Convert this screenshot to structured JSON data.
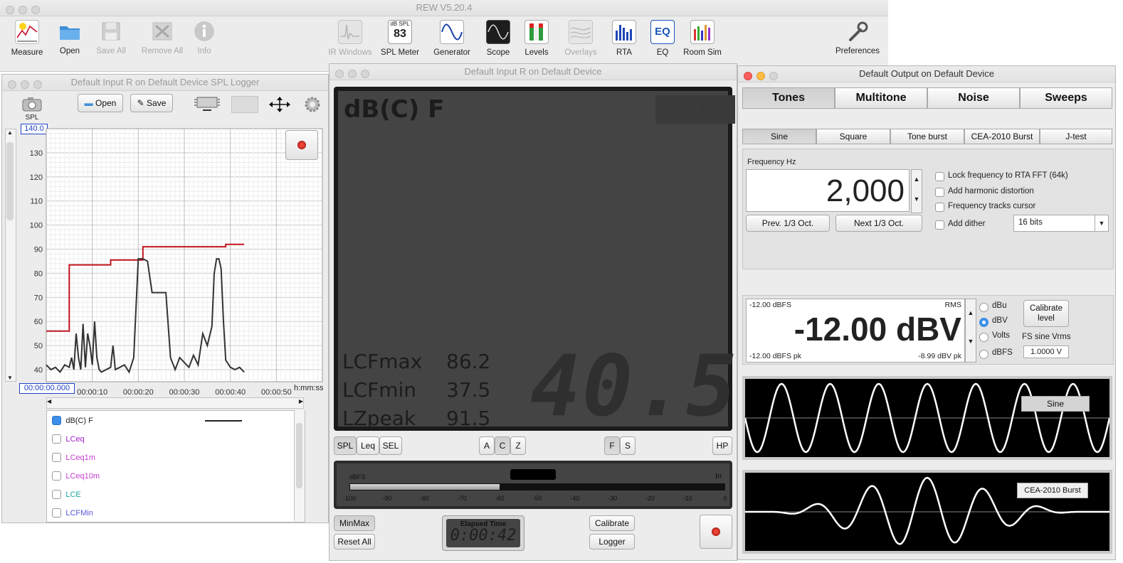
{
  "app": {
    "title": "REW V5.20.4"
  },
  "colors": {
    "accent": "#3b8fe8",
    "trace_max": "#c0141c",
    "trace_spl": "#333333"
  },
  "toolbar": [
    {
      "label": "Measure",
      "enabled": true,
      "icon": "measure-icon"
    },
    {
      "label": "Open",
      "enabled": true,
      "icon": "folder-icon"
    },
    {
      "label": "Save All",
      "enabled": false,
      "icon": "floppy-icon"
    },
    {
      "label": "Remove All",
      "enabled": false,
      "icon": "remove-icon"
    },
    {
      "label": "Info",
      "enabled": false,
      "icon": "info-icon"
    },
    {
      "label": "IR Windows",
      "enabled": false,
      "icon": "ir-windows-icon"
    },
    {
      "label": "SPL Meter",
      "enabled": true,
      "icon": "spl-meter-icon",
      "badge_top": "dB SPL",
      "badge_value": "83"
    },
    {
      "label": "Generator",
      "enabled": true,
      "icon": "sine-wave-icon"
    },
    {
      "label": "Scope",
      "enabled": true,
      "icon": "scope-icon"
    },
    {
      "label": "Levels",
      "enabled": true,
      "icon": "levels-icon"
    },
    {
      "label": "Overlays",
      "enabled": false,
      "icon": "overlays-icon"
    },
    {
      "label": "RTA",
      "enabled": true,
      "icon": "rta-icon"
    },
    {
      "label": "EQ",
      "enabled": true,
      "icon": "eq-icon",
      "badge_value": "EQ"
    },
    {
      "label": "Room Sim",
      "enabled": true,
      "icon": "room-sim-icon"
    },
    {
      "label": "Preferences",
      "enabled": true,
      "icon": "wrench-icon"
    }
  ],
  "logger": {
    "title": "Default Input R on Default Device SPL Logger",
    "spl_label": "SPL",
    "open_label": "Open",
    "save_label": "Save",
    "y_max_field": "140.0",
    "y_ticks": [
      "130",
      "120",
      "110",
      "100",
      "90",
      "80",
      "70",
      "60",
      "50",
      "40"
    ],
    "x_start_field": "00:00:00.000",
    "x_ticks": [
      "00:00:10",
      "00:00:20",
      "00:00:30",
      "00:00:40",
      "00:00:50"
    ],
    "x_unit": "h:mm:ss",
    "legend": [
      {
        "label": "dB(C) F",
        "checked": true,
        "color": "#222222"
      },
      {
        "label": "LCeq",
        "checked": false,
        "color": "#9b1fc8"
      },
      {
        "label": "LCeq1m",
        "checked": false,
        "color": "#c63fd0"
      },
      {
        "label": "LCeq10m",
        "checked": false,
        "color": "#c63fd0"
      },
      {
        "label": "LCE",
        "checked": false,
        "color": "#1aa7a0"
      },
      {
        "label": "LCFMin",
        "checked": false,
        "color": "#5a55d6"
      }
    ]
  },
  "chart_data": {
    "type": "line",
    "xlabel": "h:mm:ss",
    "ylabel": "SPL",
    "ylim": [
      35,
      140
    ],
    "xlim": [
      0,
      60
    ],
    "series": [
      {
        "name": "LCFmax",
        "x": [
          0,
          5,
          5,
          14,
          14,
          21,
          21,
          39,
          39,
          43
        ],
        "y": [
          56,
          56,
          83.5,
          83.5,
          85.5,
          85.5,
          91,
          91,
          92,
          92
        ]
      },
      {
        "name": "dB(C) F",
        "x": [
          0,
          1,
          2,
          3,
          4,
          5,
          5.5,
          6,
          6.5,
          7,
          7.5,
          8,
          8.5,
          9,
          9.5,
          10,
          10.5,
          11,
          11.5,
          12,
          13,
          14,
          14.5,
          15,
          16,
          17,
          18,
          19,
          20,
          20.5,
          21,
          22,
          23,
          24,
          25,
          26,
          27,
          28,
          29,
          30,
          31,
          32,
          33,
          34,
          35,
          36,
          36.5,
          37,
          37.5,
          38,
          38.5,
          39,
          40,
          41,
          42,
          43
        ],
        "y": [
          42,
          40,
          41,
          39,
          42,
          41,
          45,
          40,
          55,
          45,
          40,
          59,
          41,
          55,
          50,
          42,
          60,
          45,
          40,
          39,
          40,
          41,
          50,
          40,
          41,
          42,
          39,
          45,
          86,
          86,
          86,
          85,
          72,
          72,
          72,
          72,
          45,
          40,
          45,
          43,
          41,
          46,
          42,
          55,
          50,
          58,
          80,
          86,
          86,
          82,
          60,
          44,
          41,
          40,
          41,
          39
        ]
      }
    ]
  },
  "spl_meter": {
    "title": "Default Input R on Default Device",
    "weighting_label": "dB(C) F",
    "over_label": "OVER",
    "readings": [
      {
        "label": "LCFmax",
        "value": "86.2"
      },
      {
        "label": "LCFmin",
        "value": "37.5"
      },
      {
        "label": "LZpeak",
        "value": "91.5"
      }
    ],
    "big_value": "40.5",
    "mode_buttons": [
      "SPL",
      "Leq",
      "SEL"
    ],
    "weight_buttons": [
      "A",
      "C",
      "Z"
    ],
    "speed_buttons": [
      "F",
      "S"
    ],
    "hp_label": "HP",
    "dbfs_label": "dBFS",
    "in_label": "In",
    "meter_scale": [
      "-100",
      "-90",
      "-80",
      "-70",
      "-60",
      "-50",
      "-40",
      "-30",
      "-20",
      "-10",
      "0"
    ],
    "meter_level_dbfs": -60,
    "minmax_label": "MinMax",
    "reset_label": "Reset All",
    "elapsed_label": "Elapsed Time",
    "elapsed_value": "0:00:42",
    "calibrate_label": "Calibrate",
    "logger_label": "Logger"
  },
  "generator": {
    "title": "Default Output on Default Device",
    "main_tabs": [
      "Tones",
      "Multitone",
      "Noise",
      "Sweeps"
    ],
    "sub_tabs": [
      "Sine",
      "Square",
      "Tone burst",
      "CEA-2010 Burst",
      "J-test"
    ],
    "freq_label": "Frequency Hz",
    "freq_value": "2,000",
    "prev_label": "Prev. 1/3 Oct.",
    "next_label": "Next 1/3 Oct.",
    "options": [
      "Lock frequency to RTA FFT (64k)",
      "Add harmonic distortion",
      "Frequency tracks cursor",
      "Add dither"
    ],
    "bits_value": "16 bits",
    "level_top_left": "-12.00 dBFS",
    "level_top_right": "RMS",
    "level_value": "-12.00 dBV",
    "level_bottom_left": "-12.00 dBFS pk",
    "level_bottom_right": "-8.99 dBV pk",
    "units": [
      {
        "label": "dBu",
        "selected": false
      },
      {
        "label": "dBV",
        "selected": true
      },
      {
        "label": "Volts",
        "selected": false
      },
      {
        "label": "dBFS",
        "selected": false
      }
    ],
    "calibrate_label": "Calibrate level",
    "fs_label": "FS sine Vrms",
    "fs_value": "1.0000 V",
    "preview1_label": "Sine",
    "preview2_label": "CEA-2010 Burst"
  }
}
